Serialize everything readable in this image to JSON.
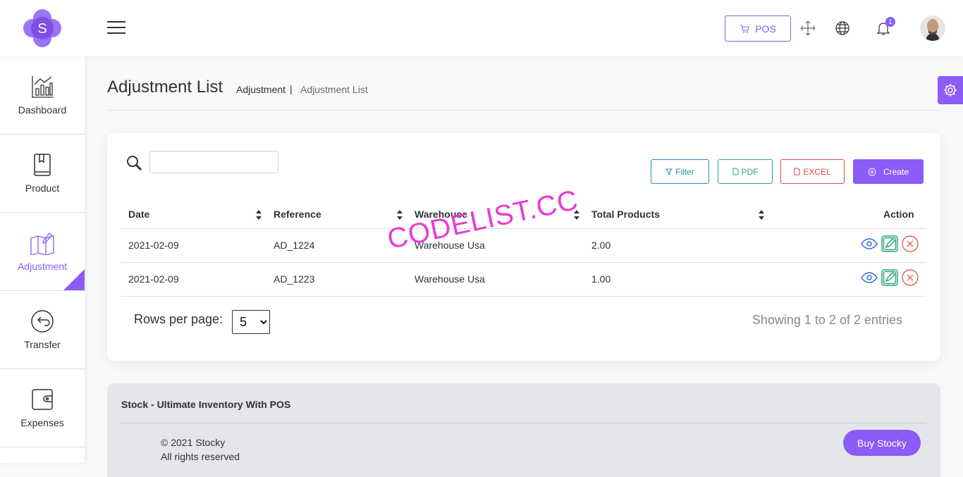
{
  "brand": {
    "logo_letter": "S",
    "accent": "#8b5cf6"
  },
  "topbar": {
    "pos_label": "POS",
    "notification_count": "1"
  },
  "sidebar": {
    "items": [
      {
        "label": "Dashboard",
        "icon": "chart-icon",
        "active": false
      },
      {
        "label": "Product",
        "icon": "book-icon",
        "active": false
      },
      {
        "label": "Adjustment",
        "icon": "map-pencil-icon",
        "active": true
      },
      {
        "label": "Transfer",
        "icon": "transfer-arrow-icon",
        "active": false
      },
      {
        "label": "Expenses",
        "icon": "wallet-icon",
        "active": false
      }
    ]
  },
  "header": {
    "title": "Adjustment List",
    "breadcrumb": [
      "Adjustment",
      "Adjustment List"
    ],
    "separator": "|"
  },
  "toolbar": {
    "search_value": "",
    "filter_label": "Filter",
    "pdf_label": "PDF",
    "excel_label": "EXCEL",
    "create_label": "Create"
  },
  "table": {
    "columns": [
      "Date",
      "Reference",
      "Warehouse",
      "Total Products",
      "Action"
    ],
    "rows": [
      {
        "date": "2021-02-09",
        "reference": "AD_1224",
        "warehouse": "Warehouse Usa",
        "total": "2.00"
      },
      {
        "date": "2021-02-09",
        "reference": "AD_1223",
        "warehouse": "Warehouse Usa",
        "total": "1.00"
      }
    ]
  },
  "pagination": {
    "rows_per_page_label": "Rows per page:",
    "rows_per_page_value": "5",
    "showing_text": "Showing 1 to 2 of 2 entries"
  },
  "watermark": "CODELIST.CC",
  "footer": {
    "title": "Stock - Ultimate Inventory With POS",
    "copyright": "© 2021 Stocky",
    "rights": "All rights reserved",
    "buy_label": "Buy Stocky"
  }
}
